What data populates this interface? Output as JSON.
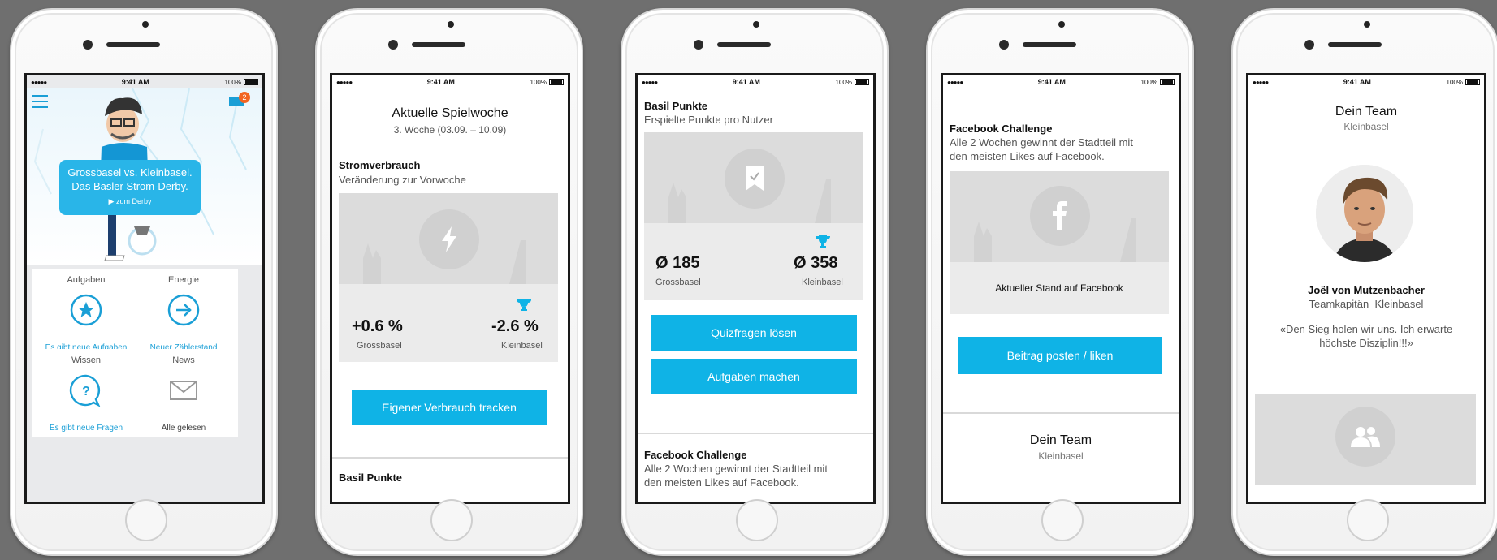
{
  "status": {
    "time": "9:41 AM",
    "battery": "100%",
    "signal": "●●●●●"
  },
  "screen1": {
    "badge": "2",
    "bubble_line1": "Grossbasel vs. Kleinbasel.",
    "bubble_line2": "Das Basler Strom-Derby.",
    "bubble_link": "zum Derby",
    "tiles": [
      {
        "title": "Aufgaben",
        "sub": "Es gibt neue Aufgaben",
        "icon": "star-icon"
      },
      {
        "title": "Energie",
        "sub": "Neuer Zählerstand",
        "icon": "arrow-right-circle-icon"
      },
      {
        "title": "Wissen",
        "sub": "Es gibt neue Fragen",
        "icon": "question-bubble-icon"
      },
      {
        "title": "News",
        "sub": "Alle gelesen",
        "icon": "mail-icon"
      }
    ]
  },
  "screen2": {
    "title": "Aktuelle Spielwoche",
    "subtitle": "3. Woche (03.09. – 10.09)",
    "section_title": "Stromverbrauch",
    "section_sub": "Veränderung zur Vorwoche",
    "left_value": "+0.6 %",
    "left_label": "Grossbasel",
    "right_value": "-2.6 %",
    "right_label": "Kleinbasel",
    "button": "Eigener Verbrauch tracken",
    "next_section": "Basil Punkte"
  },
  "screen3": {
    "title": "Basil Punkte",
    "subtitle": "Erspielte Punkte pro Nutzer",
    "left_value": "Ø 185",
    "left_label": "Grossbasel",
    "right_value": "Ø 358",
    "right_label": "Kleinbasel",
    "button1": "Quizfragen lösen",
    "button2": "Aufgaben machen",
    "fb_title": "Facebook Challenge",
    "fb_text1": "Alle 2 Wochen gewinnt der Stadtteil mit",
    "fb_text2": "den meisten Likes auf Facebook."
  },
  "screen4": {
    "title": "Facebook Challenge",
    "text1": "Alle 2 Wochen gewinnt der Stadtteil mit",
    "text2": "den meisten Likes auf Facebook.",
    "caption": "Aktueller Stand auf Facebook",
    "button": "Beitrag posten / liken",
    "team_title": "Dein Team",
    "team_sub": "Kleinbasel"
  },
  "screen5": {
    "title": "Dein Team",
    "sub": "Kleinbasel",
    "name": "Joël von Mutzenbacher",
    "role": "Teamkapitän  Kleinbasel",
    "quote1": "«Den Sieg holen wir uns. Ich erwarte",
    "quote2": "höchste Disziplin!!!»"
  },
  "colors": {
    "accent": "#0fb3e6",
    "background": "#6f6f6f",
    "placeholder": "#e4e4e4"
  }
}
